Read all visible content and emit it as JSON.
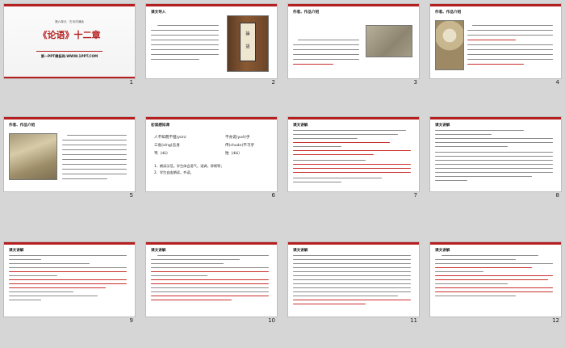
{
  "slides": [
    {
      "number": "1",
      "type": "cover",
      "subtitle": "第六单元 · 古诗词诵读",
      "title": "《论语》十二章",
      "site": "第一PPT模板网-WWW.1PPT.COM"
    },
    {
      "number": "2",
      "type": "text-image",
      "heading": "课文导入",
      "book_glyphs": [
        "論",
        "語"
      ]
    },
    {
      "number": "3",
      "type": "text-image",
      "heading": "作者、作品介绍"
    },
    {
      "number": "4",
      "type": "text-image",
      "heading": "作者、作品介绍"
    },
    {
      "number": "5",
      "type": "text-image",
      "heading": "作者、作品介绍"
    },
    {
      "number": "6",
      "type": "pinyin",
      "heading": "初读感知课",
      "rows": [
        {
          "left": "人不知而不愠(yùn)",
          "right": "不亦说(yuè)乎"
        },
        {
          "left": "三省(xǐng)吾身",
          "right": "传(chuán)不习乎"
        },
        {
          "left": "笃（dǔ）",
          "right": "殆（dài）"
        }
      ],
      "points": [
        "1、朗读示范。学生体会语气，语调，停顿等；",
        "2、学生自由朗读，齐读。"
      ]
    },
    {
      "number": "7",
      "type": "text",
      "heading": "课文讲解"
    },
    {
      "number": "8",
      "type": "text",
      "heading": "课文讲解"
    },
    {
      "number": "9",
      "type": "text",
      "heading": "课文讲解"
    },
    {
      "number": "10",
      "type": "text",
      "heading": "课文讲解"
    },
    {
      "number": "11",
      "type": "text",
      "heading": "课文讲解"
    },
    {
      "number": "12",
      "type": "text",
      "heading": "课文讲解"
    }
  ]
}
